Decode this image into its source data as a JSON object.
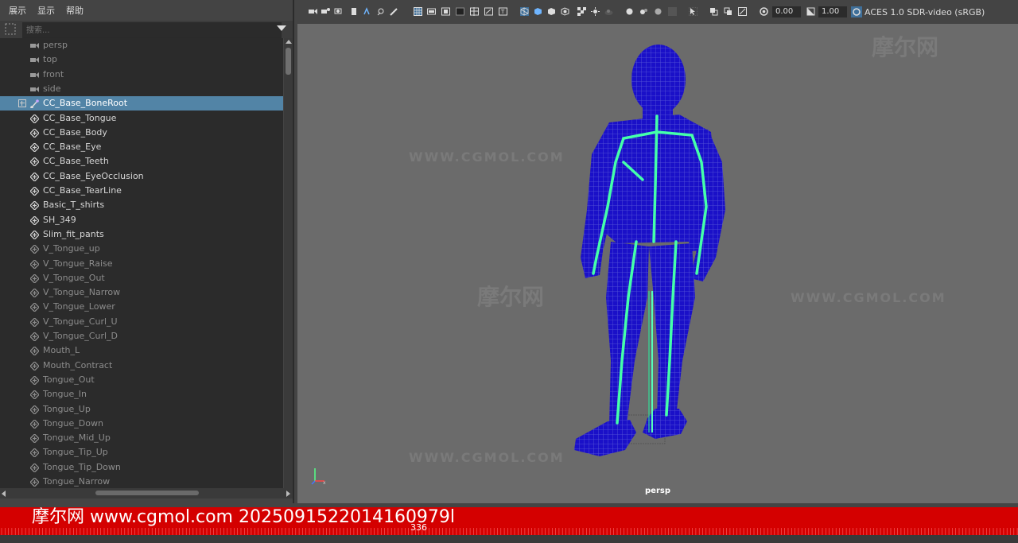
{
  "menubar": {
    "items": [
      "展示",
      "显示",
      "帮助"
    ]
  },
  "search": {
    "placeholder": "搜索..."
  },
  "outliner": {
    "items": [
      {
        "label": "persp",
        "type": "cam"
      },
      {
        "label": "top",
        "type": "cam"
      },
      {
        "label": "front",
        "type": "cam"
      },
      {
        "label": "side",
        "type": "cam"
      },
      {
        "label": "CC_Base_BoneRoot",
        "type": "joint",
        "selected": true
      },
      {
        "label": "CC_Base_Tongue",
        "type": "mesh"
      },
      {
        "label": "CC_Base_Body",
        "type": "mesh"
      },
      {
        "label": "CC_Base_Eye",
        "type": "mesh"
      },
      {
        "label": "CC_Base_Teeth",
        "type": "mesh"
      },
      {
        "label": "CC_Base_EyeOcclusion",
        "type": "mesh"
      },
      {
        "label": "CC_Base_TearLine",
        "type": "mesh"
      },
      {
        "label": "Basic_T_shirts",
        "type": "mesh"
      },
      {
        "label": "SH_349",
        "type": "mesh"
      },
      {
        "label": "Slim_fit_pants",
        "type": "mesh"
      },
      {
        "label": "V_Tongue_up",
        "type": "blend"
      },
      {
        "label": "V_Tongue_Raise",
        "type": "blend"
      },
      {
        "label": "V_Tongue_Out",
        "type": "blend"
      },
      {
        "label": "V_Tongue_Narrow",
        "type": "blend"
      },
      {
        "label": "V_Tongue_Lower",
        "type": "blend"
      },
      {
        "label": "V_Tongue_Curl_U",
        "type": "blend"
      },
      {
        "label": "V_Tongue_Curl_D",
        "type": "blend"
      },
      {
        "label": "Mouth_L",
        "type": "blend"
      },
      {
        "label": "Mouth_Contract",
        "type": "blend"
      },
      {
        "label": "Tongue_Out",
        "type": "blend"
      },
      {
        "label": "Tongue_In",
        "type": "blend"
      },
      {
        "label": "Tongue_Up",
        "type": "blend"
      },
      {
        "label": "Tongue_Down",
        "type": "blend"
      },
      {
        "label": "Tongue_Mid_Up",
        "type": "blend"
      },
      {
        "label": "Tongue_Tip_Up",
        "type": "blend"
      },
      {
        "label": "Tongue_Tip_Down",
        "type": "blend"
      },
      {
        "label": "Tongue_Narrow",
        "type": "blend"
      }
    ]
  },
  "viewport": {
    "exposure": "0.00",
    "gamma": "1.00",
    "color_management": "ACES 1.0 SDR-video (sRGB)",
    "camera": "persp",
    "mesh_color": "#1a10c8",
    "joint_color": "#44ffaa"
  },
  "timeslider": {
    "current_frame": "336",
    "watermark": "摩尔网 www.cgmol.com 2025091522014160979l",
    "color": "#d40000"
  },
  "watermarks": {
    "logo": "摩尔网",
    "site": "WWW.CGMOL.COM"
  }
}
